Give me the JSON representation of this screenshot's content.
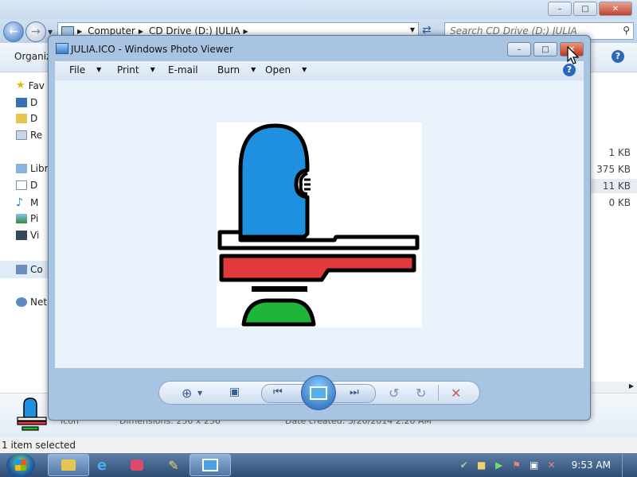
{
  "explorer": {
    "address_path": [
      "Computer",
      "CD Drive (D:) JULIA"
    ],
    "search_placeholder": "Search CD Drive (D:) JULIA",
    "toolbar": {
      "organize_label": "Organiz"
    },
    "nav": {
      "favorites_label": "Fav",
      "fav_items": [
        "D",
        "D",
        "Re"
      ],
      "libraries_label": "Libr",
      "lib_items": [
        "D",
        "M",
        "Pi",
        "Vi"
      ],
      "computer_label": "Co",
      "network_label": "Net"
    },
    "sizes": [
      "1 KB",
      "375 KB",
      "11 KB",
      "0 KB"
    ],
    "selected_size": "11 KB",
    "details": {
      "type": "Icon",
      "dimensions": "Dimensions: 256 x 256",
      "date_created": "Date created: 3/20/2014 2:20 AM"
    },
    "status_text": "1 item selected"
  },
  "viewer": {
    "title": "JULIA.ICO - Windows Photo Viewer",
    "menu": [
      "File",
      "Print",
      "E-mail",
      "Burn",
      "Open"
    ],
    "controls": {
      "zoom": "zoom-icon",
      "actual_size": "actual-size-icon",
      "previous": "previous-icon",
      "slideshow": "slideshow-icon",
      "next": "next-icon",
      "rotate_ccw": "rotate-ccw-icon",
      "rotate_cw": "rotate-cw-icon",
      "delete": "delete-icon"
    }
  },
  "taskbar": {
    "clock": "9:53 AM",
    "pinned": [
      "explorer",
      "internet-explorer",
      "media-center",
      "paint",
      "photo-viewer"
    ]
  },
  "colors": {
    "icon_blue": "#1f8fe0",
    "icon_red": "#e23a3a",
    "icon_green": "#1fb53a",
    "accent_blue": "#2e67b5"
  }
}
